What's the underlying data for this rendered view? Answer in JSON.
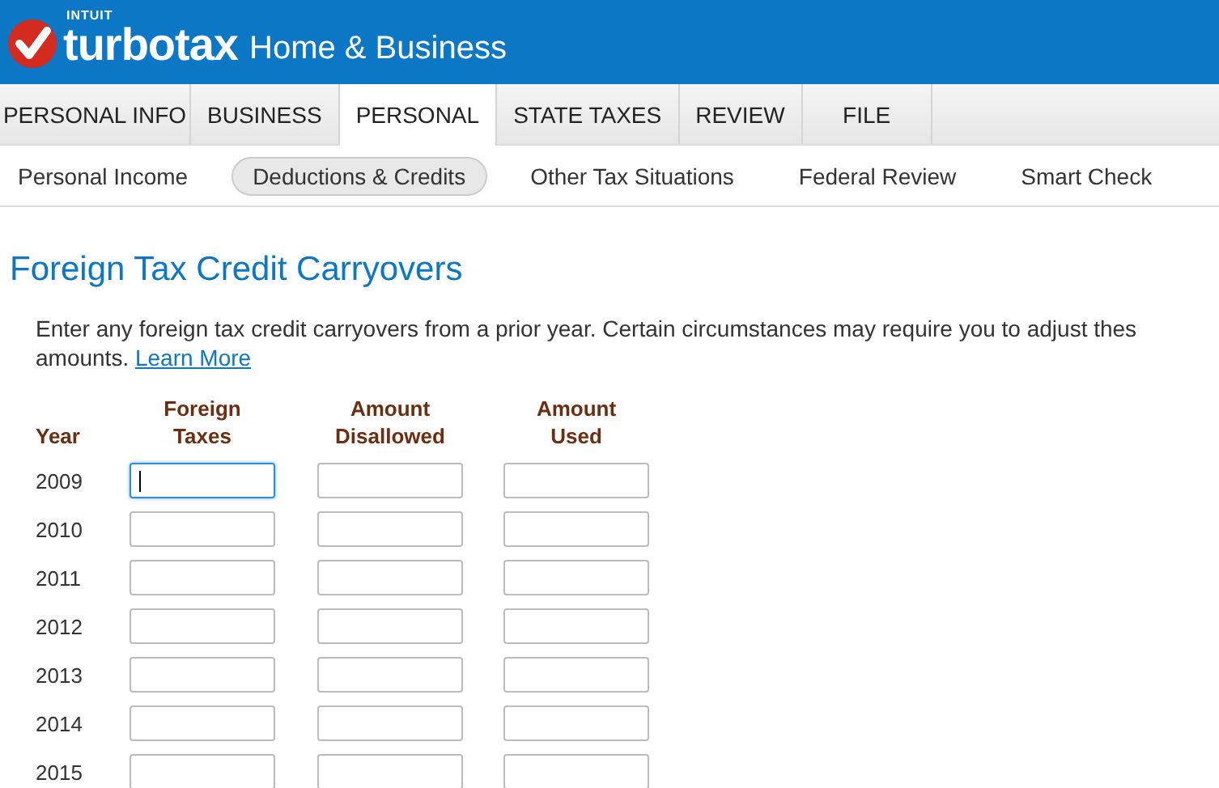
{
  "header": {
    "brand_small": "INTUIT",
    "brand": "turbotax",
    "product": "Home & Business"
  },
  "tabs": [
    {
      "label": "PERSONAL INFO",
      "selected": false
    },
    {
      "label": "BUSINESS",
      "selected": false
    },
    {
      "label": "PERSONAL",
      "selected": true
    },
    {
      "label": "STATE TAXES",
      "selected": false
    },
    {
      "label": "REVIEW",
      "selected": false
    },
    {
      "label": "FILE",
      "selected": false
    }
  ],
  "subnav": [
    {
      "label": "Personal Income",
      "selected": false
    },
    {
      "label": "Deductions & Credits",
      "selected": true
    },
    {
      "label": "Other Tax Situations",
      "selected": false
    },
    {
      "label": "Federal Review",
      "selected": false
    },
    {
      "label": "Smart Check",
      "selected": false
    }
  ],
  "title": "Foreign Tax Credit Carryovers",
  "intro_line_1": "Enter any foreign tax credit carryovers from a prior year. Certain circumstances may require you to adjust thes",
  "intro_line_2": "amounts.",
  "link": "Learn More",
  "table": {
    "columns": [
      "Year",
      "Foreign Taxes",
      "Amount Disallowed",
      "Amount Used"
    ],
    "rows": [
      {
        "year": "2009",
        "focused": true
      },
      {
        "year": "2010",
        "focused": false
      },
      {
        "year": "2011",
        "focused": false
      },
      {
        "year": "2012",
        "focused": false
      },
      {
        "year": "2013",
        "focused": false
      },
      {
        "year": "2014",
        "focused": false
      },
      {
        "year": "2015",
        "focused": false
      }
    ]
  }
}
